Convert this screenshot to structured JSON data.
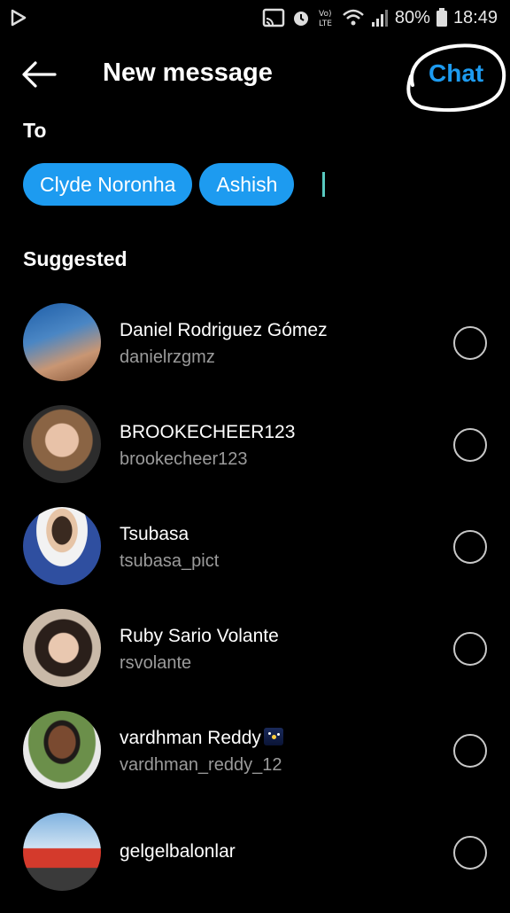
{
  "status_bar": {
    "battery": "80%",
    "time": "18:49"
  },
  "header": {
    "title": "New message",
    "chat_label": "Chat"
  },
  "to": {
    "label": "To",
    "recipients": [
      "Clyde Noronha",
      "Ashish"
    ]
  },
  "suggested": {
    "label": "Suggested",
    "items": [
      {
        "name": "Daniel Rodriguez Gómez",
        "handle": "danielrzgmz"
      },
      {
        "name": "BROOKECHEER123",
        "handle": "brookecheer123"
      },
      {
        "name": "Tsubasa",
        "handle": "tsubasa_pict"
      },
      {
        "name": "Ruby Sario Volante",
        "handle": "rsvolante"
      },
      {
        "name": "vardhman Reddy",
        "handle": "vardhman_reddy_12"
      },
      {
        "name": "gelgelbalonlar",
        "handle": ""
      }
    ]
  },
  "colors": {
    "accent": "#1d9bf0",
    "background": "#000000",
    "secondary_text": "#9b9b9b"
  }
}
